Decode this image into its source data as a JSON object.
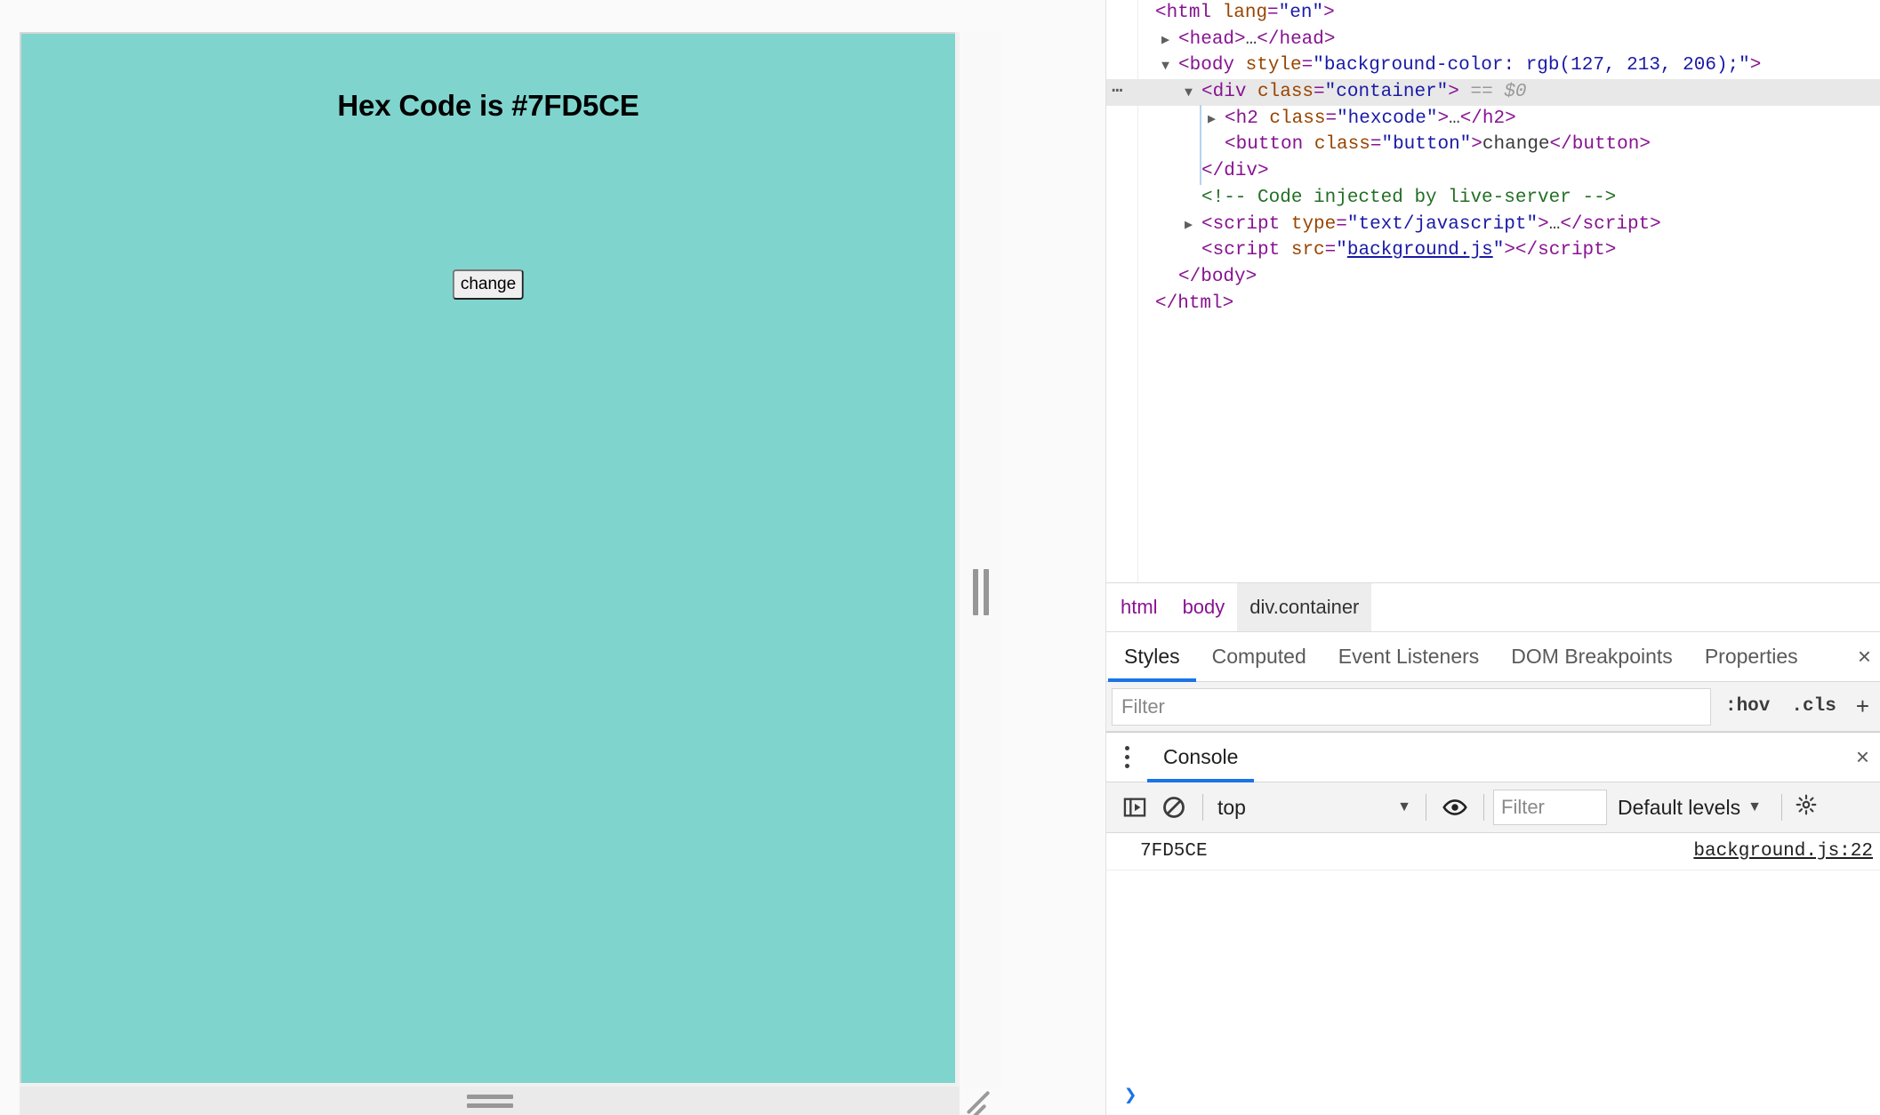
{
  "colors": {
    "page_background_hex": "#7FD5CE",
    "page_background_rgb": "rgb(127, 213, 206)",
    "accent": "#1a73e8",
    "tag": "#881391",
    "attr_name": "#994500",
    "attr_value": "#1a1aa6",
    "comment": "#236e25"
  },
  "page": {
    "heading": "Hex Code is #7FD5CE",
    "button_label": "change"
  },
  "devtools": {
    "dom_tree": {
      "lines": [
        {
          "id": "html-open",
          "indent": 0,
          "twisty": "",
          "dots": false,
          "selected": false,
          "parts": [
            {
              "t": "punc",
              "v": "<"
            },
            {
              "t": "tag",
              "v": "html"
            },
            {
              "t": "attr",
              "v": " lang"
            },
            {
              "t": "punc",
              "v": "="
            },
            {
              "t": "val",
              "v": "\"en\""
            },
            {
              "t": "punc",
              "v": ">"
            }
          ]
        },
        {
          "id": "head",
          "indent": 1,
          "twisty": "closed",
          "dots": false,
          "selected": false,
          "parts": [
            {
              "t": "punc",
              "v": "<"
            },
            {
              "t": "tag",
              "v": "head"
            },
            {
              "t": "punc",
              "v": ">"
            },
            {
              "t": "txt",
              "v": "…"
            },
            {
              "t": "punc",
              "v": "</"
            },
            {
              "t": "tag",
              "v": "head"
            },
            {
              "t": "punc",
              "v": ">"
            }
          ]
        },
        {
          "id": "body",
          "indent": 1,
          "twisty": "open",
          "dots": false,
          "selected": false,
          "parts": [
            {
              "t": "punc",
              "v": "<"
            },
            {
              "t": "tag",
              "v": "body"
            },
            {
              "t": "attr",
              "v": " style"
            },
            {
              "t": "punc",
              "v": "="
            },
            {
              "t": "val",
              "v": "\"background-color: rgb(127, 213, 206);\""
            },
            {
              "t": "punc",
              "v": ">"
            }
          ]
        },
        {
          "id": "div-container",
          "indent": 2,
          "twisty": "open",
          "dots": true,
          "selected": true,
          "parts": [
            {
              "t": "punc",
              "v": "<"
            },
            {
              "t": "tag",
              "v": "div"
            },
            {
              "t": "attr",
              "v": " class"
            },
            {
              "t": "punc",
              "v": "="
            },
            {
              "t": "val",
              "v": "\"container\""
            },
            {
              "t": "punc",
              "v": ">"
            },
            {
              "t": "eqref",
              "v": " == $0"
            }
          ]
        },
        {
          "id": "h2-hexcode",
          "indent": 3,
          "twisty": "closed",
          "dots": false,
          "selected": false,
          "parts": [
            {
              "t": "punc",
              "v": "<"
            },
            {
              "t": "tag",
              "v": "h2"
            },
            {
              "t": "attr",
              "v": " class"
            },
            {
              "t": "punc",
              "v": "="
            },
            {
              "t": "val",
              "v": "\"hexcode\""
            },
            {
              "t": "punc",
              "v": ">"
            },
            {
              "t": "txt",
              "v": "…"
            },
            {
              "t": "punc",
              "v": "</"
            },
            {
              "t": "tag",
              "v": "h2"
            },
            {
              "t": "punc",
              "v": ">"
            }
          ]
        },
        {
          "id": "button",
          "indent": 3,
          "twisty": "",
          "dots": false,
          "selected": false,
          "parts": [
            {
              "t": "punc",
              "v": "<"
            },
            {
              "t": "tag",
              "v": "button"
            },
            {
              "t": "attr",
              "v": " class"
            },
            {
              "t": "punc",
              "v": "="
            },
            {
              "t": "val",
              "v": "\"button\""
            },
            {
              "t": "punc",
              "v": ">"
            },
            {
              "t": "txt",
              "v": "change"
            },
            {
              "t": "punc",
              "v": "</"
            },
            {
              "t": "tag",
              "v": "button"
            },
            {
              "t": "punc",
              "v": ">"
            }
          ]
        },
        {
          "id": "div-close",
          "indent": 2,
          "twisty": "",
          "dots": false,
          "selected": false,
          "parts": [
            {
              "t": "punc",
              "v": "</"
            },
            {
              "t": "tag",
              "v": "div"
            },
            {
              "t": "punc",
              "v": ">"
            }
          ]
        },
        {
          "id": "comment",
          "indent": 2,
          "twisty": "",
          "dots": false,
          "selected": false,
          "parts": [
            {
              "t": "comment",
              "v": "<!-- Code injected by live-server -->"
            }
          ]
        },
        {
          "id": "script-inline",
          "indent": 2,
          "twisty": "closed",
          "dots": false,
          "selected": false,
          "parts": [
            {
              "t": "punc",
              "v": "<"
            },
            {
              "t": "tag",
              "v": "script"
            },
            {
              "t": "attr",
              "v": " type"
            },
            {
              "t": "punc",
              "v": "="
            },
            {
              "t": "val",
              "v": "\"text/javascript\""
            },
            {
              "t": "punc",
              "v": ">"
            },
            {
              "t": "txt",
              "v": "…"
            },
            {
              "t": "punc",
              "v": "</"
            },
            {
              "t": "tag",
              "v": "script"
            },
            {
              "t": "punc",
              "v": ">"
            }
          ]
        },
        {
          "id": "script-src",
          "indent": 2,
          "twisty": "",
          "dots": false,
          "selected": false,
          "parts": [
            {
              "t": "punc",
              "v": "<"
            },
            {
              "t": "tag",
              "v": "script"
            },
            {
              "t": "attr",
              "v": " src"
            },
            {
              "t": "punc",
              "v": "="
            },
            {
              "t": "val",
              "v": "\""
            },
            {
              "t": "link",
              "v": "background.js"
            },
            {
              "t": "val",
              "v": "\""
            },
            {
              "t": "punc",
              "v": ">"
            },
            {
              "t": "punc",
              "v": "</"
            },
            {
              "t": "tag",
              "v": "script"
            },
            {
              "t": "punc",
              "v": ">"
            }
          ]
        },
        {
          "id": "body-close",
          "indent": 1,
          "twisty": "",
          "dots": false,
          "selected": false,
          "parts": [
            {
              "t": "punc",
              "v": "</"
            },
            {
              "t": "tag",
              "v": "body"
            },
            {
              "t": "punc",
              "v": ">"
            }
          ]
        },
        {
          "id": "html-close",
          "indent": 0,
          "twisty": "",
          "dots": false,
          "selected": false,
          "parts": [
            {
              "t": "punc",
              "v": "</"
            },
            {
              "t": "tag",
              "v": "html"
            },
            {
              "t": "punc",
              "v": ">"
            }
          ]
        }
      ]
    },
    "breadcrumb": [
      {
        "label": "html",
        "active": false
      },
      {
        "label": "body",
        "active": false
      },
      {
        "label": "div.container",
        "active": true
      }
    ],
    "sidebar_tabs": [
      {
        "label": "Styles",
        "active": true
      },
      {
        "label": "Computed",
        "active": false
      },
      {
        "label": "Event Listeners",
        "active": false
      },
      {
        "label": "DOM Breakpoints",
        "active": false
      },
      {
        "label": "Properties",
        "active": false
      }
    ],
    "sidebar_close_label": "×",
    "styles_filter": {
      "value": "",
      "placeholder": "Filter",
      "hov_label": ":hov",
      "cls_label": ".cls",
      "new_rule_label": "+"
    },
    "console": {
      "tabs": [
        {
          "label": "Console",
          "active": true
        }
      ],
      "drawer_close_label": "×",
      "toolbar": {
        "sidebar_toggle_icon": "console-sidebar-icon",
        "clear_icon": "clear-console-icon",
        "context": "top",
        "context_caret": "▼",
        "live_expression_icon": "eye-icon",
        "filter_value": "",
        "filter_placeholder": "Filter",
        "levels_label": "Default levels",
        "levels_caret": "▼",
        "settings_icon": "gear-icon"
      },
      "messages": [
        {
          "text": "7FD5CE",
          "source": "background.js:22"
        }
      ],
      "prompt_glyph": "❯"
    }
  }
}
